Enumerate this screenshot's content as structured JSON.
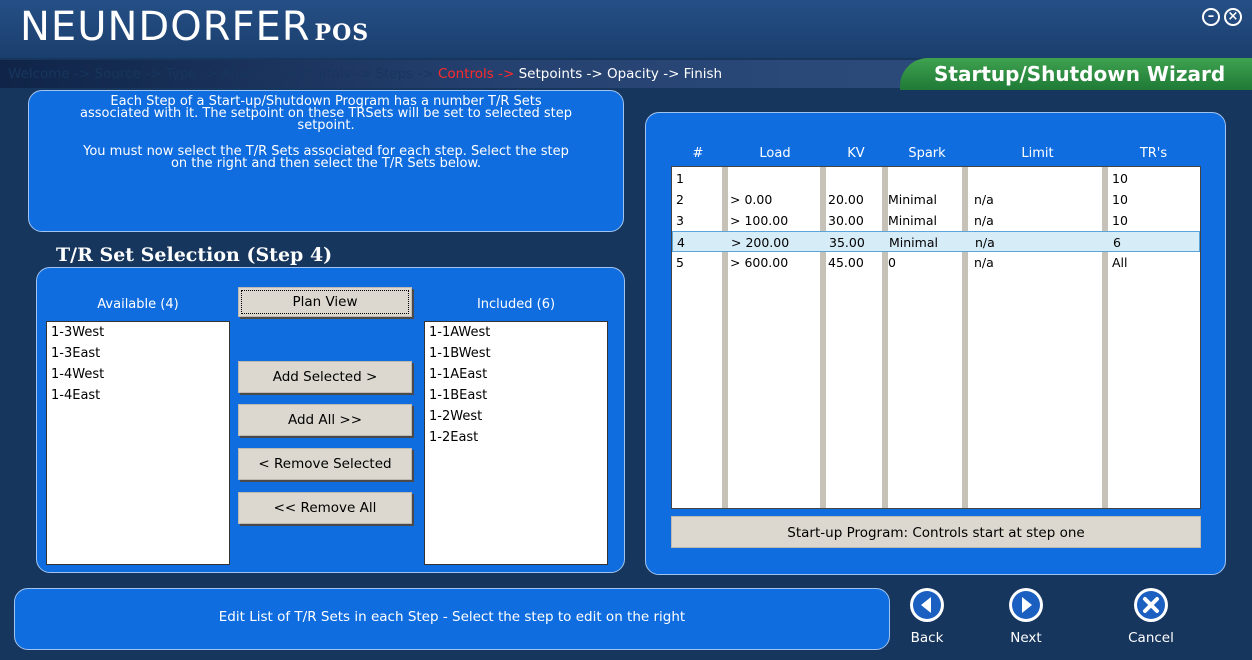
{
  "app": {
    "brand": "NEUNDORFER",
    "brand_suffix": "POS"
  },
  "window": {
    "minimize_icon": "minimize-circle-icon",
    "close_icon": "close-circle-icon"
  },
  "breadcrumbs": {
    "done": "Welcome -> Source -> Type -> Analogs -> Digitals -> Steps -> ",
    "current": "Controls -> ",
    "todo": "Setpoints -> Opacity -> Finish"
  },
  "wizard_title": "Startup/Shutdown Wizard",
  "info": {
    "line1": "Each Step of a Start-up/Shutdown Program has a number T/R Sets",
    "line2": "associated with it. The setpoint on these TRSets will be set to selected step",
    "line3": "setpoint.",
    "line4": "You must now select the T/R Sets associated for each step. Select the step",
    "line5": "on the right and then select the T/R Sets below."
  },
  "selection": {
    "title": "T/R Set Selection (Step 4)",
    "available_label": "Available (4)",
    "included_label": "Included (6)",
    "available": [
      "1-3West",
      "1-3East",
      "1-4West",
      "1-4East"
    ],
    "included": [
      "1-1AWest",
      "1-1BWest",
      "1-1AEast",
      "1-1BEast",
      "1-2West",
      "1-2East"
    ],
    "buttons": {
      "plan_view": "Plan View",
      "add_selected": "Add Selected >",
      "add_all": "Add All >>",
      "remove_selected": "< Remove Selected",
      "remove_all": "<< Remove All"
    }
  },
  "steps_grid": {
    "headers": [
      "#",
      "Load",
      "KV",
      "Spark",
      "Limit",
      "TR's"
    ],
    "rows": [
      [
        "1",
        "",
        "",
        "",
        "",
        "10"
      ],
      [
        "2",
        "> 0.00",
        "20.00",
        "Minimal",
        "n/a",
        "10"
      ],
      [
        "3",
        "> 100.00",
        "30.00",
        "Minimal",
        "n/a",
        "10"
      ],
      [
        "4",
        "> 200.00",
        "35.00",
        "Minimal",
        "n/a",
        "6"
      ],
      [
        "5",
        "> 600.00",
        "45.00",
        "0",
        "n/a",
        "All"
      ]
    ],
    "selected_row": 3,
    "status": "Start-up Program: Controls start at step one"
  },
  "footer": {
    "message": "Edit List of T/R Sets in each Step - Select the step to edit on the right",
    "back": "Back",
    "next": "Next",
    "cancel": "Cancel"
  }
}
